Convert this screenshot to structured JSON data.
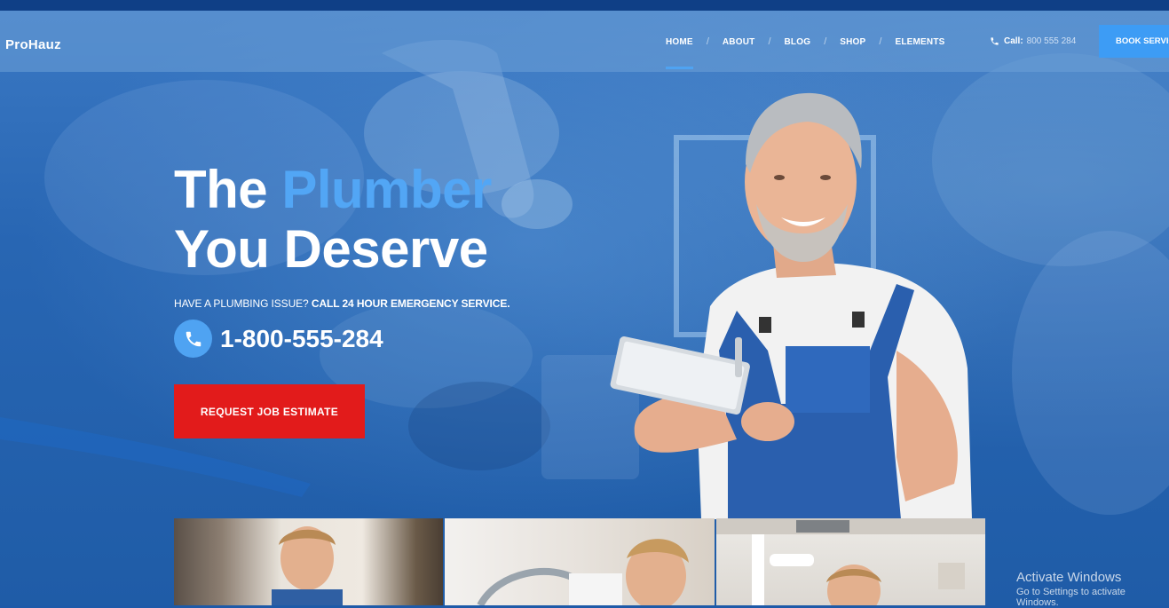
{
  "brand": {
    "name": "ProHauz"
  },
  "nav": {
    "items": [
      {
        "label": "HOME",
        "active": true
      },
      {
        "label": "ABOUT"
      },
      {
        "label": "BLOG"
      },
      {
        "label": "SHOP"
      },
      {
        "label": "ELEMENTS"
      }
    ],
    "separator": "/",
    "call_label": "Call:",
    "call_number": "800 555 284",
    "book_button": "BOOK SERVICE"
  },
  "hero": {
    "headline_word1": "The",
    "headline_accent": "Plumber",
    "headline_line2": "You Deserve",
    "sub_regular": "HAVE A PLUMBING ISSUE?",
    "sub_bold": "CALL 24 HOUR EMERGENCY SERVICE.",
    "phone": "1-800-555-284",
    "cta": "REQUEST JOB ESTIMATE"
  },
  "watermark": {
    "title": "Activate Windows",
    "subtitle": "Go to Settings to activate Windows."
  },
  "colors": {
    "accent_blue": "#4fa3f2",
    "cta_red": "#e21b1b",
    "hero_blue": "#2866b3"
  },
  "icons": [
    "phone-icon"
  ]
}
